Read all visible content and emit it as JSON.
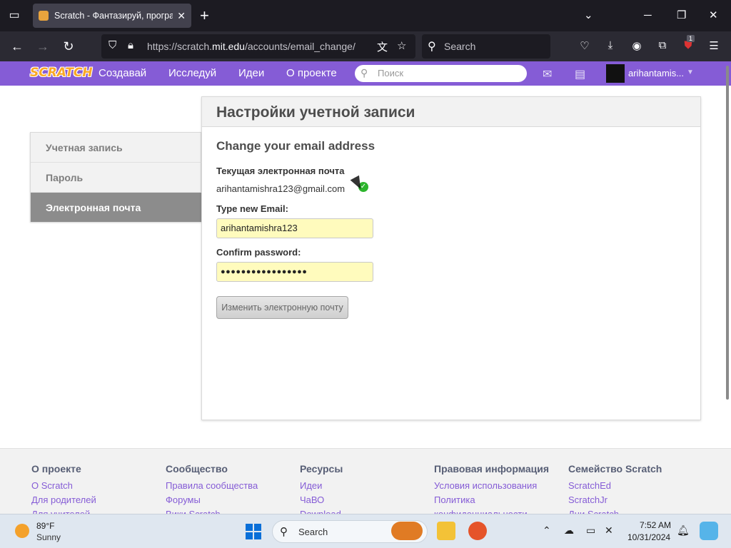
{
  "browser": {
    "tab_title": "Scratch - Фантазируй, програм",
    "url_prefix": "https://scratch.",
    "url_domain": "mit.edu",
    "url_path": "/accounts/email_change/",
    "search_placeholder": "Search",
    "extension_badge": "1"
  },
  "site": {
    "logo": "SCRATCH",
    "nav": [
      "Создавай",
      "Исследуй",
      "Идеи",
      "О проекте"
    ],
    "search_placeholder": "Поиск",
    "username": "arihantamis..."
  },
  "sidebar": {
    "items": [
      {
        "label": "Учетная запись"
      },
      {
        "label": "Пароль"
      },
      {
        "label": "Электронная почта"
      }
    ]
  },
  "panel": {
    "title": "Настройки учетной записи",
    "heading": "Change your email address",
    "current_label": "Текущая электронная почта",
    "current_email": "arihantamishra123@gmail.com",
    "new_email_label": "Type new Email:",
    "new_email_value": "arihantamishra123",
    "password_label": "Confirm password:",
    "password_value": "●●●●●●●●●●●●●●●●●",
    "submit_label": "Изменить электронную почту"
  },
  "footer": {
    "columns": [
      {
        "heading": "О проекте",
        "links": [
          "О Scratch",
          "Для родителей",
          "Для учителей"
        ]
      },
      {
        "heading": "Сообщество",
        "links": [
          "Правила сообщества",
          "Форумы",
          "Вики Scratch"
        ]
      },
      {
        "heading": "Ресурсы",
        "links": [
          "Идеи",
          "ЧаВО",
          "Download"
        ]
      },
      {
        "heading": "Правовая информация",
        "links": [
          "Условия использования",
          "Политика",
          "конфиденциальности"
        ]
      },
      {
        "heading": "Семейство Scratch",
        "links": [
          "ScratchEd",
          "ScratchJr",
          "Дни Scratch"
        ]
      }
    ]
  },
  "taskbar": {
    "temperature": "89°F",
    "weather": "Sunny",
    "search_placeholder": "Search",
    "time": "7:52 AM",
    "date": "10/31/2024"
  },
  "colors": {
    "scratch_purple": "#855cd6",
    "field_yellow": "#fffbbd",
    "sidebar_active": "#8c8c8c"
  }
}
